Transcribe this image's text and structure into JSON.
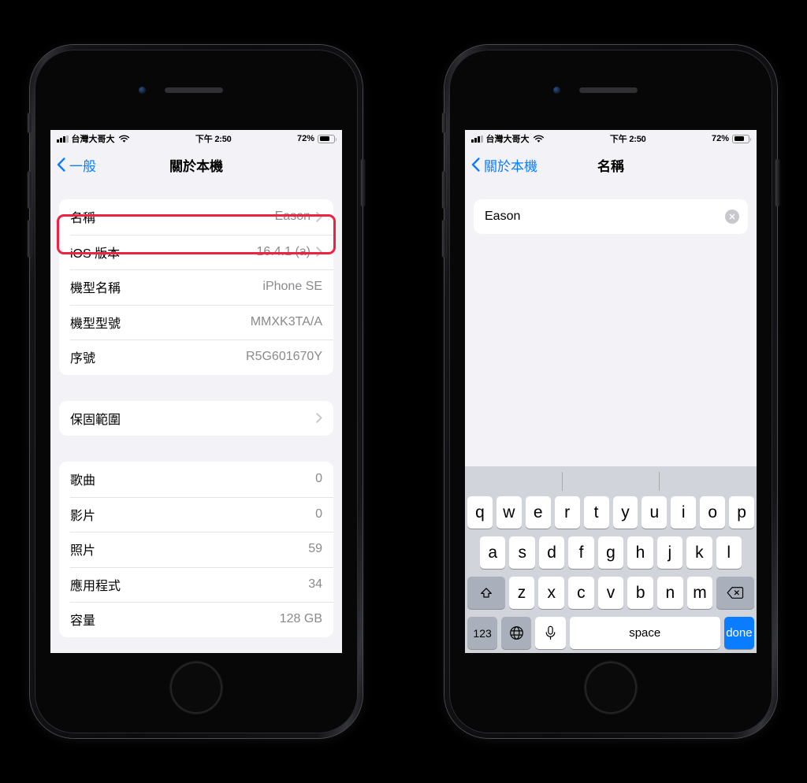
{
  "status_bar": {
    "carrier": "台灣大哥大",
    "time": "下午 2:50",
    "battery_percent": "72%",
    "battery_level": 72,
    "signal_icon": "cellular-bars-icon",
    "wifi_icon": "wifi-icon",
    "battery_icon": "battery-icon"
  },
  "left_phone": {
    "nav": {
      "back_label": "一般",
      "back_icon": "chevron-left-icon",
      "title": "關於本機"
    },
    "highlight_color": "#ee2344",
    "group1": [
      {
        "label": "名稱",
        "value": "Eason",
        "chevron": true,
        "highlighted": true
      },
      {
        "label": "iOS 版本",
        "value": "16.4.1 (a)",
        "chevron": true,
        "highlighted": false
      },
      {
        "label": "機型名稱",
        "value": "iPhone SE",
        "chevron": false,
        "highlighted": false
      },
      {
        "label": "機型型號",
        "value": "MMXK3TA/A",
        "chevron": false,
        "highlighted": false
      },
      {
        "label": "序號",
        "value": "R5G601670Y",
        "chevron": false,
        "highlighted": false
      }
    ],
    "group2": [
      {
        "label": "保固範圍",
        "value": "",
        "chevron": true,
        "highlighted": false
      }
    ],
    "group3": [
      {
        "label": "歌曲",
        "value": "0",
        "chevron": false,
        "highlighted": false
      },
      {
        "label": "影片",
        "value": "0",
        "chevron": false,
        "highlighted": false
      },
      {
        "label": "照片",
        "value": "59",
        "chevron": false,
        "highlighted": false
      },
      {
        "label": "應用程式",
        "value": "34",
        "chevron": false,
        "highlighted": false
      },
      {
        "label": "容量",
        "value": "128 GB",
        "chevron": false,
        "highlighted": false
      }
    ]
  },
  "right_phone": {
    "nav": {
      "back_label": "關於本機",
      "back_icon": "chevron-left-icon",
      "title": "名稱"
    },
    "name_field": {
      "value": "Eason",
      "placeholder": "名稱",
      "clear_icon": "clear-circle-icon"
    },
    "keyboard": {
      "row1": [
        "q",
        "w",
        "e",
        "r",
        "t",
        "y",
        "u",
        "i",
        "o",
        "p"
      ],
      "row2": [
        "a",
        "s",
        "d",
        "f",
        "g",
        "h",
        "j",
        "k",
        "l"
      ],
      "row3": [
        "z",
        "x",
        "c",
        "v",
        "b",
        "n",
        "m"
      ],
      "shift_icon": "shift-up-arrow-icon",
      "backspace_icon": "backspace-delete-icon",
      "numbers_label": "123",
      "globe_icon": "globe-language-icon",
      "mic_icon": "microphone-icon",
      "space_label": "space",
      "done_label": "done",
      "done_color": "#0a7cff"
    }
  }
}
